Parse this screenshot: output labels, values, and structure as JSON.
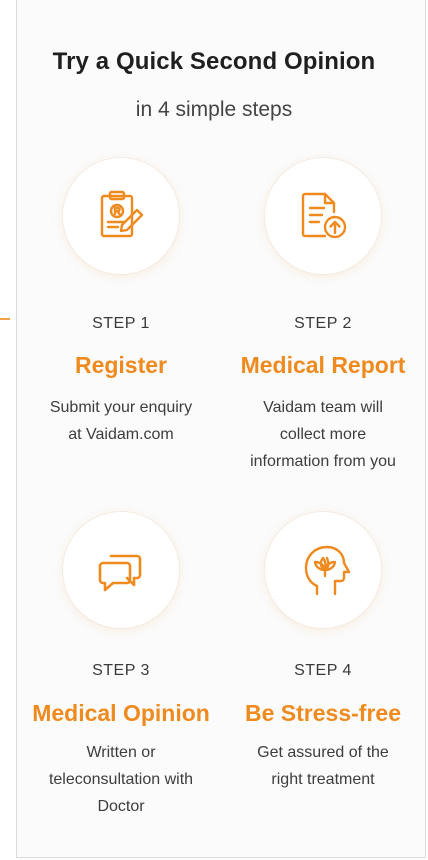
{
  "header": {
    "title": "Try a Quick Second Opinion",
    "subtitle": "in 4 simple steps"
  },
  "steps": [
    {
      "label": "STEP 1",
      "heading": "Register",
      "desc_lines": [
        "Submit your enquiry",
        "at Vaidam.com"
      ],
      "icon": "registration-form-icon"
    },
    {
      "label": "STEP 2",
      "heading": "Medical Report",
      "desc_lines": [
        "Vaidam team will",
        "collect more",
        "information from you"
      ],
      "icon": "document-upload-icon"
    },
    {
      "label": "STEP 3",
      "heading": "Medical Opinion",
      "desc_lines": [
        "Written or",
        "teleconsultation with",
        "Doctor"
      ],
      "icon": "chat-bubbles-icon"
    },
    {
      "label": "STEP 4",
      "heading": "Be Stress-free",
      "desc_lines": [
        "Get assured of the",
        "right treatment"
      ],
      "icon": "mind-lotus-icon"
    }
  ],
  "colors": {
    "accent": "#ef8a1f",
    "title": "#1f1f1f",
    "text": "#3d3d3d"
  }
}
